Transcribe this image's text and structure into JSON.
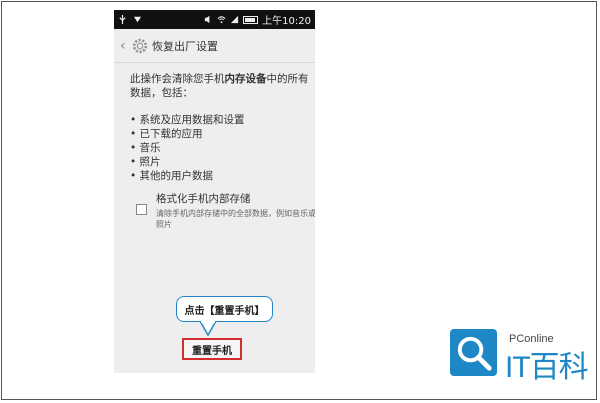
{
  "statusbar": {
    "time": "上午10:20"
  },
  "header": {
    "title": "恢复出厂设置"
  },
  "main": {
    "desc_part1": "此操作会清除您手机",
    "desc_bold": "内存设备",
    "desc_part2": "中的所有数据，包括：",
    "bullets": [
      "• 系统及应用数据和设置",
      "• 已下载的应用",
      "• 音乐",
      "• 照片",
      "• 其他的用户数据"
    ],
    "format_option": {
      "label": "格式化手机内部存储",
      "description": "清除手机内部存储中的全部数据，例如音乐或照片",
      "checked": false
    },
    "reset_button": "重置手机"
  },
  "callout": {
    "text": "点击【重置手机】"
  },
  "watermark": {
    "subtitle": "PConline",
    "title": "IT百科"
  },
  "colors": {
    "accent": "#1e88c7",
    "highlight": "#d32f2f"
  }
}
